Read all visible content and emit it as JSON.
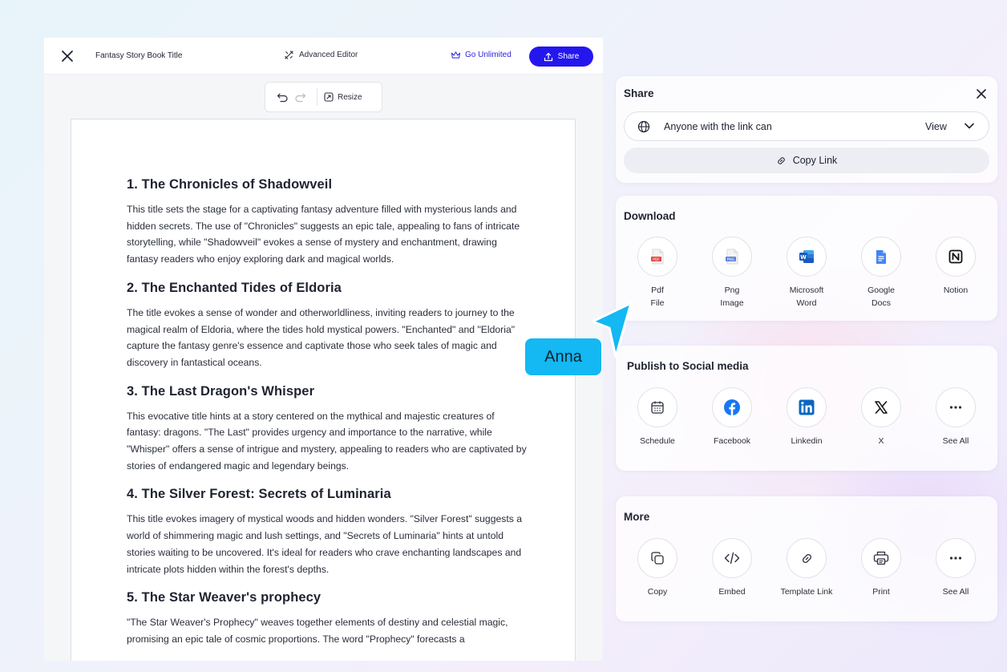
{
  "editor": {
    "doc_title": "Fantasy Story Book Title",
    "advanced_editor": "Advanced Editor",
    "go_unlimited": "Go Unlimited",
    "share": "Share",
    "resize": "Resize"
  },
  "document": {
    "sections": [
      {
        "heading": "1. The Chronicles of Shadowveil",
        "body": "This title sets the stage for a captivating fantasy adventure filled with mysterious lands and hidden secrets. The use of \"Chronicles\" suggests an epic tale, appealing to fans of intricate storytelling, while \"Shadowveil\" evokes a sense of mystery and enchantment, drawing fantasy readers who enjoy exploring dark and magical worlds."
      },
      {
        "heading": "2. The Enchanted Tides of Eldoria",
        "body": "The title evokes a sense of wonder and otherworldliness, inviting readers to journey to the magical realm of Eldoria, where the tides hold mystical powers. \"Enchanted\" and \"Eldoria\" capture the fantasy genre's essence and captivate those who seek tales of magic and discovery in fantastical oceans."
      },
      {
        "heading": "3. The Last Dragon's Whisper",
        "body": "This evocative title hints at a story centered on the mythical and majestic creatures of fantasy: dragons. \"The Last\" provides urgency and importance to the narrative, while \"Whisper\" offers a sense of intrigue and mystery, appealing to readers who are captivated by stories of endangered magic and legendary beings."
      },
      {
        "heading": "4. The Silver Forest: Secrets of Luminaria",
        "body": "This title evokes imagery of mystical woods and hidden wonders. \"Silver Forest\" suggests a world of shimmering magic and lush settings, and \"Secrets of Luminaria\" hints at untold stories waiting to be uncovered. It's ideal for readers who crave enchanting landscapes and intricate plots hidden within the forest's depths."
      },
      {
        "heading": "5. The Star Weaver's prophecy",
        "body": "\"The Star Weaver's Prophecy\" weaves together elements of destiny and celestial magic, promising an epic tale of cosmic proportions. The word \"Prophecy\" forecasts a"
      }
    ]
  },
  "cursor_name": "Anna",
  "share_panel": {
    "title": "Share",
    "access_text": "Anyone with the link can",
    "permission": "View",
    "copy_link": "Copy Link"
  },
  "download": {
    "title": "Download",
    "items": [
      {
        "label": "Pdf\nFile",
        "icon": "pdf-file-icon"
      },
      {
        "label": "Png\nImage",
        "icon": "png-image-icon"
      },
      {
        "label": "Microsoft\nWord",
        "icon": "microsoft-word-icon"
      },
      {
        "label": "Google\nDocs",
        "icon": "google-docs-icon"
      },
      {
        "label": "Notion",
        "icon": "notion-icon"
      }
    ]
  },
  "social": {
    "title": "Publish to Social media",
    "items": [
      {
        "label": "Schedule",
        "icon": "calendar-icon"
      },
      {
        "label": "Facebook",
        "icon": "facebook-icon"
      },
      {
        "label": "Linkedin",
        "icon": "linkedin-icon"
      },
      {
        "label": "X",
        "icon": "x-icon"
      },
      {
        "label": "See All",
        "icon": "more-icon"
      }
    ]
  },
  "more": {
    "title": "More",
    "items": [
      {
        "label": "Copy",
        "icon": "copy-icon"
      },
      {
        "label": "Embed",
        "icon": "embed-code-icon"
      },
      {
        "label": "Template Link",
        "icon": "link-icon"
      },
      {
        "label": "Print",
        "icon": "printer-icon"
      },
      {
        "label": "See All",
        "icon": "more-icon"
      }
    ]
  },
  "colors": {
    "primary": "#2417ee",
    "cursor": "#14b8f2",
    "facebook": "#1877f2",
    "linkedin": "#0a66c2",
    "word": "#185abd",
    "google_docs": "#4285f4",
    "pdf": "#e5463b"
  }
}
